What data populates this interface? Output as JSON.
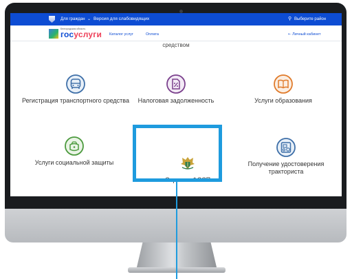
{
  "topbar": {
    "for_citizens": "Для граждан",
    "accessibility": "Версия для слабовидящих",
    "choose_region": "Выберите район",
    "chevron_icon": "chevron-down-icon",
    "location_icon": "map-pin-icon"
  },
  "header": {
    "logo_subtitle": "Белгородская область",
    "logo_part1": "гос",
    "logo_part2": "услуги",
    "nav_catalog": "Каталог услуг",
    "nav_payment": "Оплата",
    "personal_account": "Личный кабинет"
  },
  "content": {
    "previous_tile_tail": "средством",
    "tiles": [
      {
        "label": "Регистрация транспортного средства",
        "icon": "car-icon"
      },
      {
        "label": "Налоговая задолженность",
        "icon": "tax-document-icon"
      },
      {
        "label": "Услуги образования",
        "icon": "book-icon"
      },
      {
        "label": "Услуги социальной защиты",
        "icon": "wallet-icon"
      },
      {
        "label": "Сервисы ФССП",
        "icon": "fssp-emblem-icon"
      },
      {
        "label": "Получение удостоверения тракториста",
        "icon": "tractor-license-icon"
      }
    ]
  },
  "colors": {
    "brand_blue": "#0d4cd3",
    "brand_red": "#ee3f58",
    "highlight": "#1e9bde",
    "icon_blue": "#3e6fa8",
    "icon_purple": "#7a3f8c",
    "icon_orange": "#e07a2a",
    "icon_green": "#4c9a3e"
  }
}
